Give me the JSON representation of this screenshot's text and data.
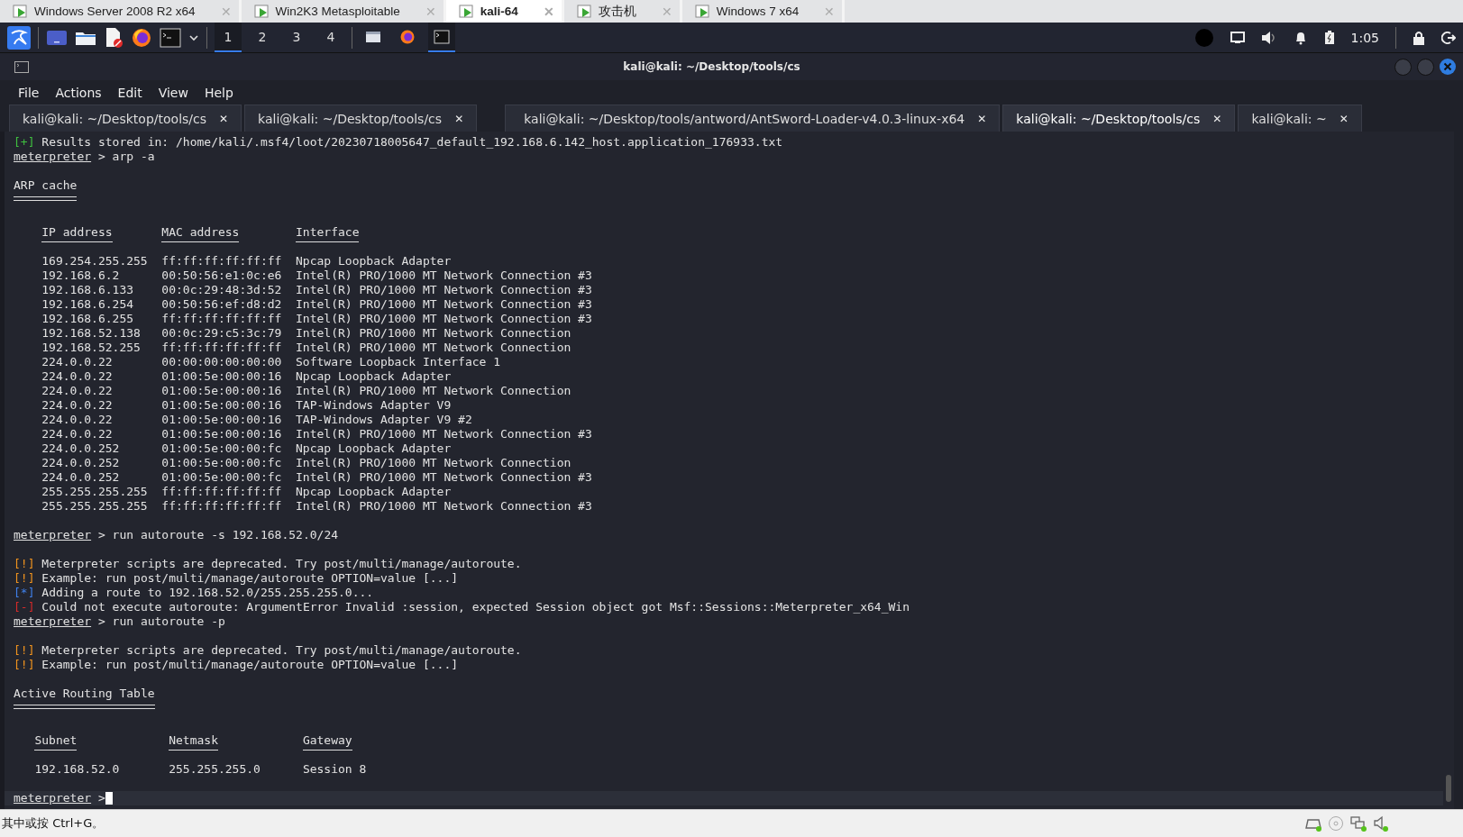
{
  "vm_tabs": [
    {
      "label": "Windows Server 2008 R2 x64",
      "selected": false,
      "close": "✕"
    },
    {
      "label": "Win2K3 Metasploitable",
      "selected": false,
      "close": "✕"
    },
    {
      "label": "kali-64",
      "selected": true,
      "close": "✕"
    },
    {
      "label": "攻击机",
      "selected": false,
      "close": "✕"
    },
    {
      "label": "Windows 7 x64",
      "selected": false,
      "close": "✕"
    }
  ],
  "panel": {
    "workspaces": [
      {
        "label": "1",
        "selected": true
      },
      {
        "label": "2",
        "selected": false
      },
      {
        "label": "3",
        "selected": false
      },
      {
        "label": "4",
        "selected": false
      }
    ],
    "tasks": [
      {
        "kind": "window",
        "selected": false
      },
      {
        "kind": "browser",
        "selected": false
      },
      {
        "kind": "terminal",
        "selected": true
      }
    ],
    "clock": "1:05"
  },
  "window": {
    "title": "kali@kali: ~/Desktop/tools/cs"
  },
  "menu": [
    "File",
    "Actions",
    "Edit",
    "View",
    "Help"
  ],
  "terminal_tabs": [
    {
      "label": "kali@kali: ~/Desktop/tools/cs",
      "selected": false,
      "close": "✕"
    },
    {
      "label": "kali@kali: ~/Desktop/tools/cs",
      "selected": false,
      "close": "✕"
    },
    {
      "label": "kali@kali: ~/Desktop/tools/antword/AntSword-Loader-v4.0.3-linux-x64",
      "selected": false,
      "close": "✕"
    },
    {
      "label": "kali@kali: ~/Desktop/tools/cs",
      "selected": true,
      "close": "✕"
    },
    {
      "label": "kali@kali: ~",
      "selected": false,
      "close": "✕"
    }
  ],
  "terminal": [
    {
      "kind": "status",
      "tag": "[+]",
      "color": "#3fbf3f",
      "text": "Results stored in: /home/kali/.msf4/loot/20230718005647_default_192.168.6.142_host.application_176933.txt"
    },
    {
      "kind": "prompt",
      "prompt": "meterpreter",
      "command": "> arp -a"
    },
    {
      "kind": "blank"
    },
    {
      "kind": "heading",
      "text": "ARP cache"
    },
    {
      "kind": "blank"
    },
    {
      "kind": "table",
      "columns": [
        "IP address",
        "MAC address",
        "Interface"
      ],
      "rows": [
        [
          "169.254.255.255",
          "ff:ff:ff:ff:ff:ff",
          "Npcap Loopback Adapter"
        ],
        [
          "192.168.6.2",
          "00:50:56:e1:0c:e6",
          "Intel(R) PRO/1000 MT Network Connection #3"
        ],
        [
          "192.168.6.133",
          "00:0c:29:48:3d:52",
          "Intel(R) PRO/1000 MT Network Connection #3"
        ],
        [
          "192.168.6.254",
          "00:50:56:ef:d8:d2",
          "Intel(R) PRO/1000 MT Network Connection #3"
        ],
        [
          "192.168.6.255",
          "ff:ff:ff:ff:ff:ff",
          "Intel(R) PRO/1000 MT Network Connection #3"
        ],
        [
          "192.168.52.138",
          "00:0c:29:c5:3c:79",
          "Intel(R) PRO/1000 MT Network Connection"
        ],
        [
          "192.168.52.255",
          "ff:ff:ff:ff:ff:ff",
          "Intel(R) PRO/1000 MT Network Connection"
        ],
        [
          "224.0.0.22",
          "00:00:00:00:00:00",
          "Software Loopback Interface 1"
        ],
        [
          "224.0.0.22",
          "01:00:5e:00:00:16",
          "Npcap Loopback Adapter"
        ],
        [
          "224.0.0.22",
          "01:00:5e:00:00:16",
          "Intel(R) PRO/1000 MT Network Connection"
        ],
        [
          "224.0.0.22",
          "01:00:5e:00:00:16",
          "TAP-Windows Adapter V9"
        ],
        [
          "224.0.0.22",
          "01:00:5e:00:00:16",
          "TAP-Windows Adapter V9 #2"
        ],
        [
          "224.0.0.22",
          "01:00:5e:00:00:16",
          "Intel(R) PRO/1000 MT Network Connection #3"
        ],
        [
          "224.0.0.252",
          "01:00:5e:00:00:fc",
          "Npcap Loopback Adapter"
        ],
        [
          "224.0.0.252",
          "01:00:5e:00:00:fc",
          "Intel(R) PRO/1000 MT Network Connection"
        ],
        [
          "224.0.0.252",
          "01:00:5e:00:00:fc",
          "Intel(R) PRO/1000 MT Network Connection #3"
        ],
        [
          "255.255.255.255",
          "ff:ff:ff:ff:ff:ff",
          "Npcap Loopback Adapter"
        ],
        [
          "255.255.255.255",
          "ff:ff:ff:ff:ff:ff",
          "Intel(R) PRO/1000 MT Network Connection #3"
        ]
      ]
    },
    {
      "kind": "blank"
    },
    {
      "kind": "prompt",
      "prompt": "meterpreter",
      "command": "> run autoroute -s 192.168.52.0/24"
    },
    {
      "kind": "blank"
    },
    {
      "kind": "status",
      "tag": "[!]",
      "color": "#f0931e",
      "text": "Meterpreter scripts are deprecated. Try post/multi/manage/autoroute."
    },
    {
      "kind": "status",
      "tag": "[!]",
      "color": "#f0931e",
      "text": "Example: run post/multi/manage/autoroute OPTION=value [...]"
    },
    {
      "kind": "status",
      "tag": "[*]",
      "color": "#3f7fe8",
      "text": "Adding a route to 192.168.52.0/255.255.255.0..."
    },
    {
      "kind": "status",
      "tag": "[-]",
      "color": "#d42a2a",
      "text": "Could not execute autoroute: ArgumentError Invalid :session, expected Session object got Msf::Sessions::Meterpreter_x64_Win"
    },
    {
      "kind": "prompt",
      "prompt": "meterpreter",
      "command": "> run autoroute -p"
    },
    {
      "kind": "blank"
    },
    {
      "kind": "status",
      "tag": "[!]",
      "color": "#f0931e",
      "text": "Meterpreter scripts are deprecated. Try post/multi/manage/autoroute."
    },
    {
      "kind": "status",
      "tag": "[!]",
      "color": "#f0931e",
      "text": "Example: run post/multi/manage/autoroute OPTION=value [...]"
    },
    {
      "kind": "blank"
    },
    {
      "kind": "heading",
      "text": "Active Routing Table"
    },
    {
      "kind": "blank"
    },
    {
      "kind": "table",
      "columns": [
        "Subnet",
        "Netmask",
        "Gateway"
      ],
      "rows": [
        [
          "192.168.52.0",
          "255.255.255.0",
          "Session 8"
        ]
      ]
    },
    {
      "kind": "blank"
    },
    {
      "kind": "prompt",
      "prompt": "meterpreter",
      "command": ">",
      "cursor": true
    }
  ],
  "status_bar": {
    "text": "其中或按 Ctrl+G。"
  }
}
